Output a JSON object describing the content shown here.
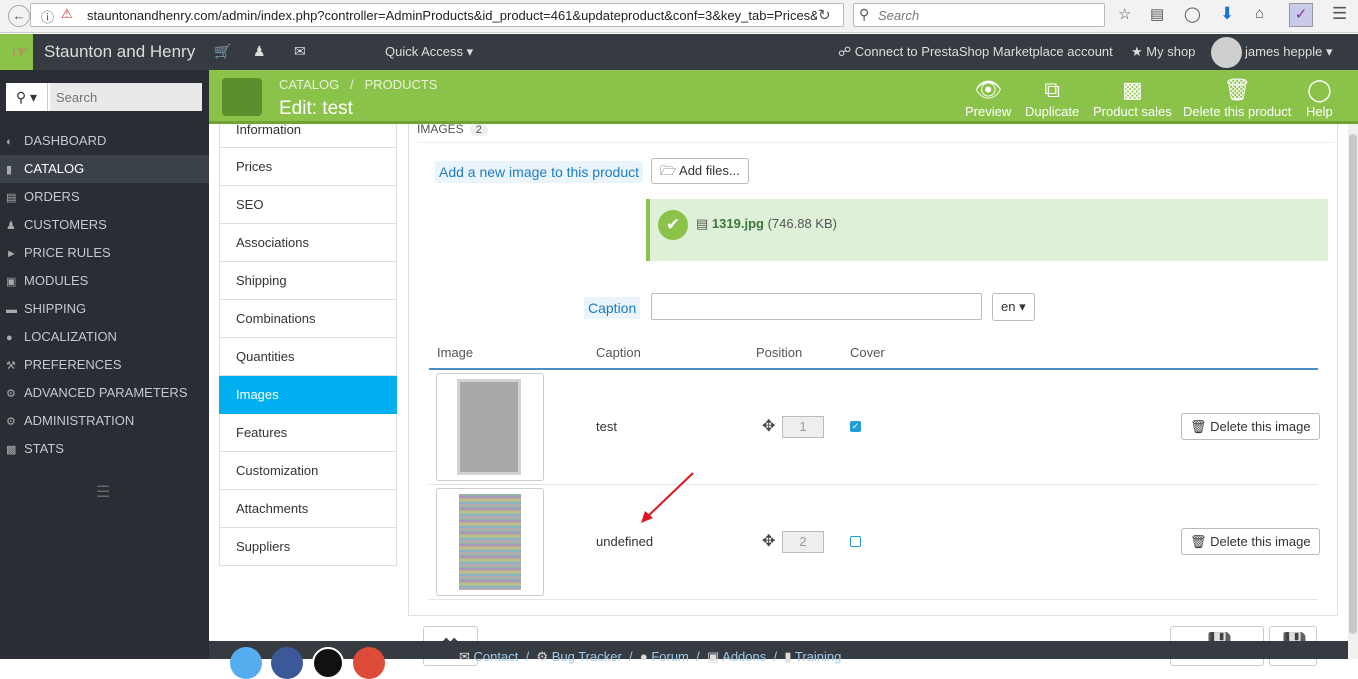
{
  "browser": {
    "url": "stauntonandhenry.com/admin/index.php?controller=AdminProducts&id_product=461&updateproduct&conf=3&key_tab=Prices&t",
    "search_placeholder": "Search"
  },
  "topbar": {
    "shop_name": "Staunton and Henry",
    "quick_access": "Quick Access",
    "connect": "Connect to PrestaShop Marketplace account",
    "my_shop": "My shop",
    "user": "james hepple"
  },
  "sidebar": {
    "search_placeholder": "Search",
    "items": [
      {
        "label": "DASHBOARD",
        "icon": "dashboard-icon"
      },
      {
        "label": "CATALOG",
        "icon": "book-icon"
      },
      {
        "label": "ORDERS",
        "icon": "credit-card-icon"
      },
      {
        "label": "CUSTOMERS",
        "icon": "users-icon"
      },
      {
        "label": "PRICE RULES",
        "icon": "tags-icon"
      },
      {
        "label": "MODULES",
        "icon": "puzzle-icon"
      },
      {
        "label": "SHIPPING",
        "icon": "truck-icon"
      },
      {
        "label": "LOCALIZATION",
        "icon": "globe-icon"
      },
      {
        "label": "PREFERENCES",
        "icon": "wrench-icon"
      },
      {
        "label": "ADVANCED PARAMETERS",
        "icon": "cogs-icon"
      },
      {
        "label": "ADMINISTRATION",
        "icon": "cog-icon"
      },
      {
        "label": "STATS",
        "icon": "bar-chart-icon"
      }
    ]
  },
  "header": {
    "breadcrumb_1": "CATALOG",
    "breadcrumb_sep": "/",
    "breadcrumb_2": "PRODUCTS",
    "title": "Edit: test",
    "actions": {
      "preview": "Preview",
      "duplicate": "Duplicate",
      "product_sales": "Product sales",
      "delete": "Delete this product",
      "help": "Help"
    }
  },
  "tabs": [
    "Information",
    "Prices",
    "SEO",
    "Associations",
    "Shipping",
    "Combinations",
    "Quantities",
    "Images",
    "Features",
    "Customization",
    "Attachments",
    "Suppliers"
  ],
  "images_panel": {
    "title": "IMAGES",
    "count": "2",
    "add_label": "Add a new image to this product",
    "add_files": "Add files...",
    "upload_file": "1319.jpg",
    "upload_size": "(746.88 KB)",
    "caption_label": "Caption",
    "lang": "en",
    "columns": {
      "image": "Image",
      "caption": "Caption",
      "position": "Position",
      "cover": "Cover"
    },
    "rows": [
      {
        "caption": "test",
        "position": "1",
        "cover": true,
        "delete": "Delete this image"
      },
      {
        "caption": "undefined",
        "position": "2",
        "cover": false,
        "delete": "Delete this image"
      }
    ]
  },
  "footer": {
    "contact": "Contact",
    "bug_tracker": "Bug Tracker",
    "forum": "Forum",
    "addons": "Addons",
    "training": "Training"
  }
}
